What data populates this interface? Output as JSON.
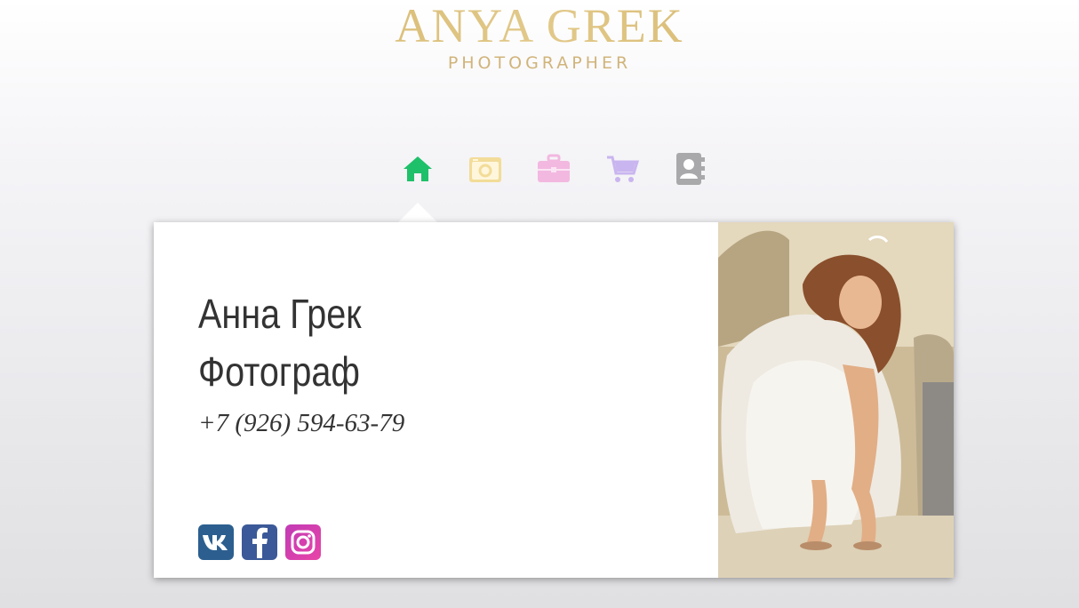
{
  "logo": {
    "name": "ANYA GREK",
    "subtitle": "PHOTOGRAPHER"
  },
  "nav": [
    {
      "icon": "home-icon",
      "color": "#1fc06a"
    },
    {
      "icon": "camera-icon",
      "color": "#f2dc98"
    },
    {
      "icon": "briefcase-icon",
      "color": "#f2b8e0"
    },
    {
      "icon": "cart-icon",
      "color": "#c9b5ef"
    },
    {
      "icon": "contacts-icon",
      "color": "#a9a9ab"
    }
  ],
  "card": {
    "name": "Анна Грек",
    "title": "Фотограф",
    "phone": "+7 (926) 594-63-79"
  },
  "social": [
    {
      "icon": "vk-icon",
      "color": "#2c5f8f"
    },
    {
      "icon": "facebook-icon",
      "color": "#3b5998"
    },
    {
      "icon": "instagram-icon",
      "color": "#d93fae"
    }
  ]
}
